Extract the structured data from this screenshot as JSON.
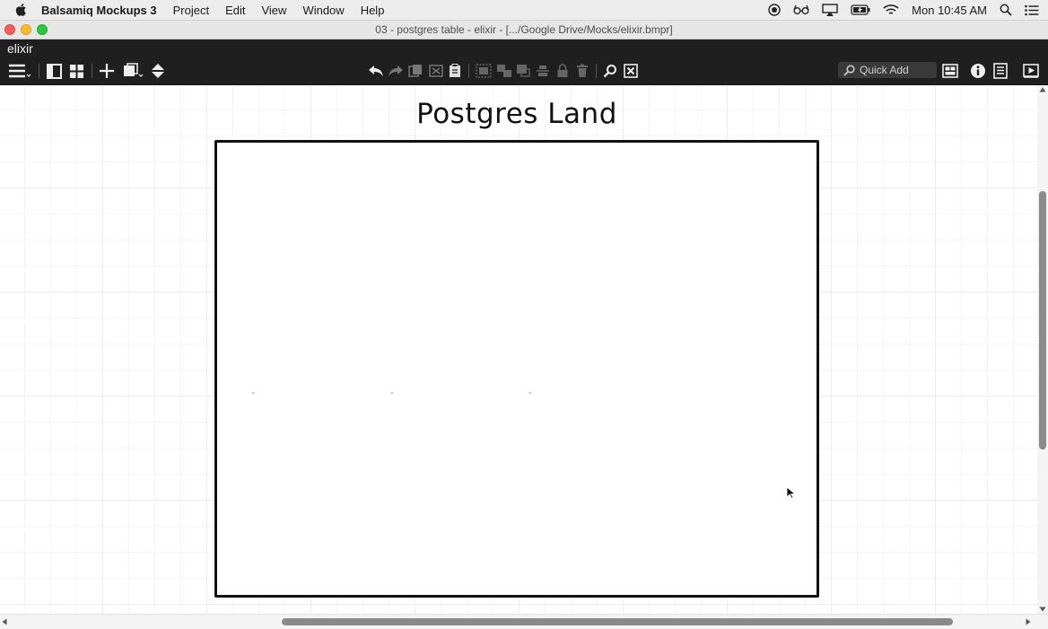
{
  "menubar": {
    "app_name": "Balsamiq Mockups 3",
    "items": [
      "Project",
      "Edit",
      "View",
      "Window",
      "Help"
    ],
    "clock": "Mon 10:45 AM"
  },
  "window": {
    "title": "03 - postgres table - elixir - [.../Google Drive/Mocks/elixir.bmpr]"
  },
  "project": {
    "name": "elixir"
  },
  "toolbar": {
    "quick_add_placeholder": "Quick Add"
  },
  "mockup": {
    "title": "Postgres Land",
    "dashes": [
      "-",
      "-",
      "-"
    ]
  },
  "colors": {
    "toolbar_bg": "#1f1f1f",
    "menubar_bg": "#ececec",
    "canvas_bg": "#ffffff"
  }
}
